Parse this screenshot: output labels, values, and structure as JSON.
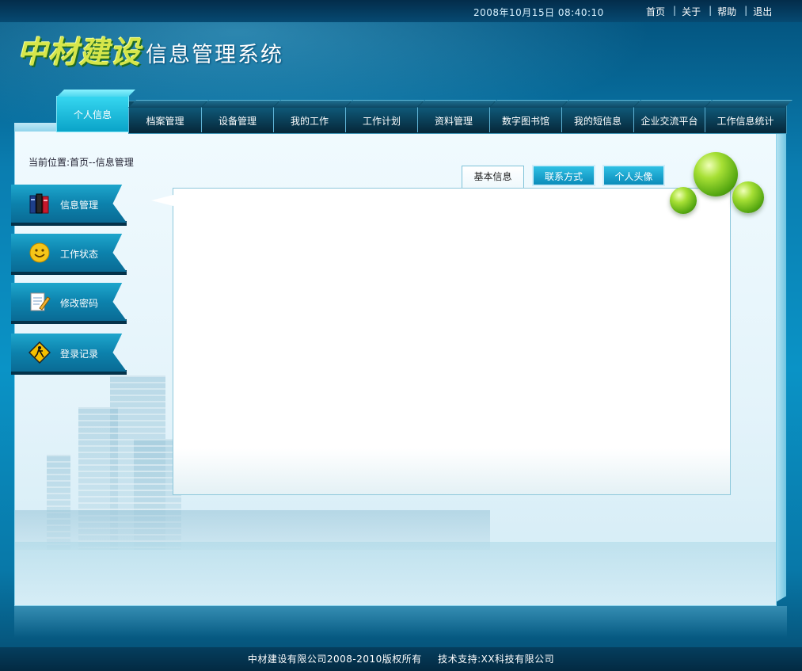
{
  "header": {
    "datetime": "2008年10月15日   08:40:10",
    "links": [
      "首页",
      "关于",
      "帮助",
      "退出"
    ]
  },
  "logo": {
    "brand": "中材建设",
    "system_name": "信息管理系统",
    "brand_color": "#d6e64a"
  },
  "nav": {
    "tabs": [
      {
        "label": "个人信息",
        "active": true
      },
      {
        "label": "档案管理"
      },
      {
        "label": "设备管理"
      },
      {
        "label": "我的工作"
      },
      {
        "label": "工作计划"
      },
      {
        "label": "资料管理"
      },
      {
        "label": "数字图书馆"
      },
      {
        "label": "我的短信息"
      },
      {
        "label": "企业交流平台"
      },
      {
        "label": "工作信息统计"
      }
    ]
  },
  "breadcrumb": "当前位置:首页--信息管理",
  "sidebar": {
    "items": [
      {
        "label": "信息管理",
        "icon": "books-icon"
      },
      {
        "label": "工作状态",
        "icon": "smiley-icon"
      },
      {
        "label": "修改密码",
        "icon": "edit-document-icon"
      },
      {
        "label": "登录记录",
        "icon": "warning-sign-icon"
      }
    ]
  },
  "content": {
    "tabs": [
      {
        "label": "基本信息",
        "active": true
      },
      {
        "label": "联系方式"
      },
      {
        "label": "个人头像"
      }
    ]
  },
  "footer": {
    "copyright": "中材建设有限公司2008-2010版权所有",
    "support": "技术支持:XX科技有限公司"
  },
  "colors": {
    "accent": "#0a93c6",
    "active_tab": "#36d6f0",
    "sphere": "#a7e035"
  }
}
